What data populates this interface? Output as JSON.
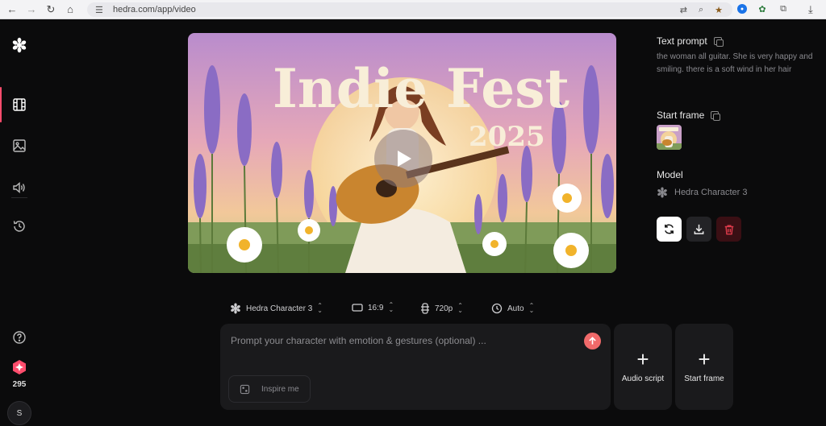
{
  "browser": {
    "url": "hedra.com/app/video"
  },
  "sidebar": {
    "items": [
      {
        "icon": "hedra-logo-icon"
      },
      {
        "icon": "film-icon",
        "active": true
      },
      {
        "icon": "image-icon"
      },
      {
        "icon": "audio-icon"
      },
      {
        "icon": "history-icon"
      },
      {
        "icon": "help-icon"
      }
    ],
    "credits": "295",
    "avatar_initial": "S",
    "accent": "#ff4d6d"
  },
  "video": {
    "title_line1": "Indie Fest",
    "title_line2": "2025"
  },
  "details": {
    "text_prompt_label": "Text prompt",
    "text_prompt": "the woman all guitar. She is very happy and smiling. there is a soft wind in her hair",
    "start_frame_label": "Start frame",
    "model_label": "Model",
    "model_value": "Hedra Character 3"
  },
  "options": {
    "model": "Hedra Character 3",
    "aspect": "16:9",
    "resolution": "720p",
    "duration": "Auto"
  },
  "composer": {
    "placeholder": "Prompt your character with emotion & gestures (optional) ...",
    "inspire_label": "Inspire me",
    "audio_script_label": "Audio script",
    "start_frame_label": "Start frame"
  }
}
